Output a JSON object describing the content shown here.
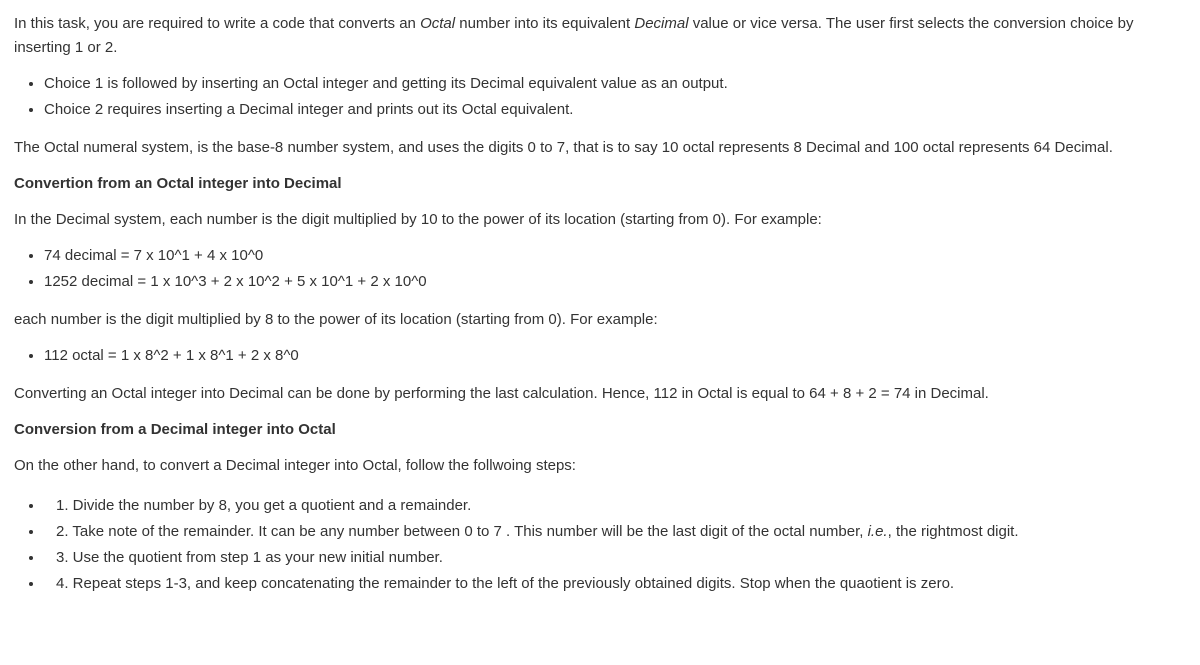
{
  "intro": {
    "part1": "In this task, you are required to write a code that converts an ",
    "emph1": "Octal",
    "part2": " number into its equivalent ",
    "emph2": "Decimal",
    "part3": " value or vice versa. The user first selects the conversion choice by inserting 1 or 2."
  },
  "choices": [
    "Choice 1 is followed by inserting an Octal integer and getting its Decimal equivalent value as an output.",
    "Choice 2 requires inserting a Decimal integer and prints out its Octal equivalent."
  ],
  "octal_def": "The Octal numeral system, is the base-8 number system, and uses the digits 0 to 7, that is to say 10 octal represents 8 Decimal and 100 octal represents 64 Decimal.",
  "heading1": "Convertion from an Octal integer into Decimal",
  "decimal_expl": "In the Decimal system, each number is the digit multiplied by 10 to the power of its location (starting from 0). For example:",
  "decimal_examples": [
    "74 decimal = 7 x 10^1 + 4 x 10^0",
    "1252 decimal = 1 x 10^3 + 2 x 10^2 + 5 x 10^1 + 2 x 10^0"
  ],
  "octal_expl": "each number is the digit multiplied by 8 to the power of its location (starting from 0). For example:",
  "octal_examples": [
    "112 octal = 1 x 8^2 + 1 x 8^1 + 2 x 8^0"
  ],
  "oct_conclusion": "Converting an Octal integer into Decimal can be done by performing the last calculation. Hence, 112 in Octal is equal to 64 + 8 + 2 = 74 in Decimal.",
  "heading2": "Conversion from a Decimal integer into Octal",
  "dec2oct_intro": "On the other hand, to convert a Decimal integer into Octal, follow the follwoing steps:",
  "steps": {
    "s1": "1. Divide the number by 8, you get a quotient and a remainder.",
    "s2a": "2. Take note of the remainder. It can be any number between 0 to 7 . This number will be the last digit of the octal number, ",
    "s2b": "i.e.",
    "s2c": ", the rightmost digit.",
    "s3": "3. Use the quotient from step 1 as your new initial number.",
    "s4": "4. Repeat steps 1-3, and keep concatenating the remainder to the left of the previously obtained digits. Stop when the quaotient is zero."
  }
}
